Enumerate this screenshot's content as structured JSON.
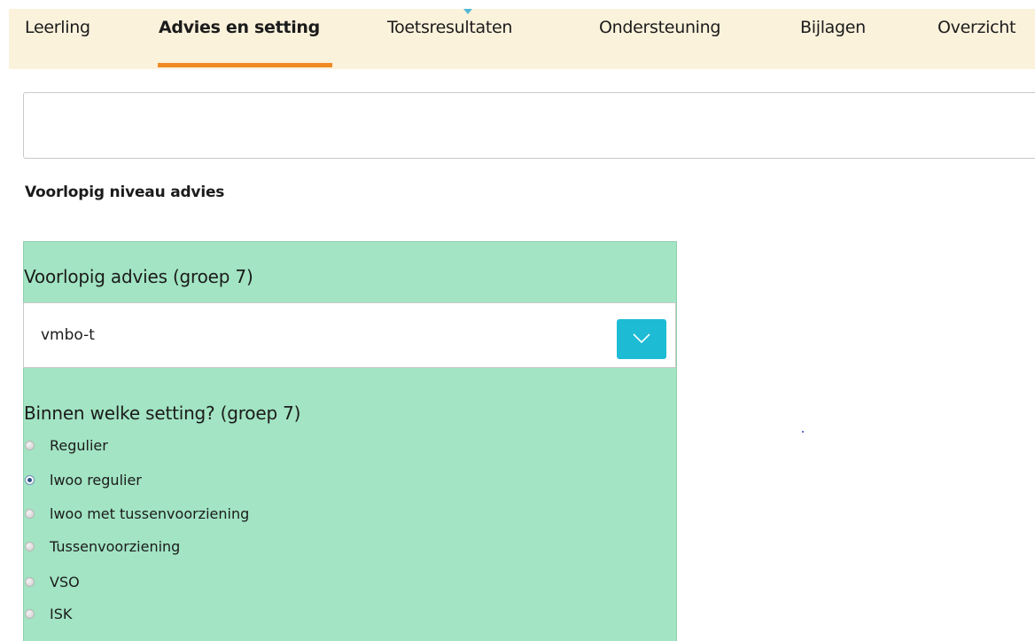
{
  "tabs": [
    {
      "label": "Leerling"
    },
    {
      "label": "Advies en setting"
    },
    {
      "label": "Toetsresultaten"
    },
    {
      "label": "Ondersteuning"
    },
    {
      "label": "Bijlagen"
    },
    {
      "label": "Overzicht"
    }
  ],
  "active_tab": "Advies en setting",
  "text_box": {
    "value": ""
  },
  "section_title": "Voorlopig niveau advies",
  "advice": {
    "label": "Voorlopig advies (groep 7)",
    "selected_value": "vmbo-t"
  },
  "setting": {
    "label": "Binnen welke setting? (groep 7)",
    "options": [
      {
        "label": "Regulier",
        "checked": false
      },
      {
        "label": "lwoo regulier",
        "checked": true
      },
      {
        "label": "lwoo met tussenvoorziening",
        "checked": false
      },
      {
        "label": "Tussenvoorziening",
        "checked": false
      },
      {
        "label": "VSO",
        "checked": false
      },
      {
        "label": "ISK",
        "checked": false
      }
    ]
  },
  "colors": {
    "tabbar_bg": "#fbf2dc",
    "active_tab_underline": "#f08a24",
    "panel_bg": "#a2e4c3",
    "dropdown_button": "#1dbcd4"
  },
  "icons": {
    "dropdown": "chevron-down-icon",
    "tab_marker": "triangle-down-icon"
  }
}
